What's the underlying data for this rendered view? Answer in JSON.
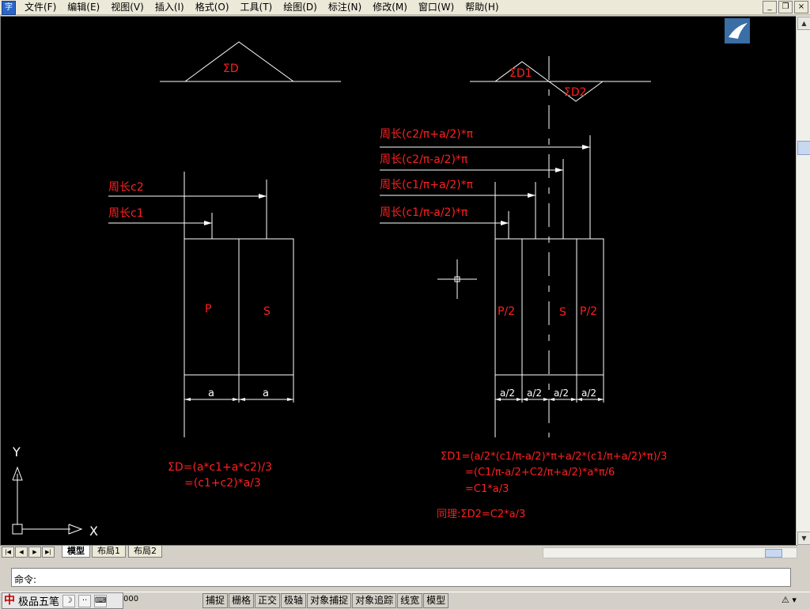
{
  "app": {
    "icon_label": "字",
    "menu": [
      "文件(F)",
      "编辑(E)",
      "视图(V)",
      "插入(I)",
      "格式(O)",
      "工具(T)",
      "绘图(D)",
      "标注(N)",
      "修改(M)",
      "窗口(W)",
      "帮助(H)"
    ],
    "window_buttons": [
      "_",
      "❐",
      "×"
    ]
  },
  "drawing": {
    "left": {
      "sum_label": "ΣD",
      "c2_label": "周长c2",
      "c1_label": "周长c1",
      "p_label": "P",
      "s_label": "S",
      "dim_a1": "a",
      "dim_a2": "a",
      "formula_line1": "ΣD=(a*c1+a*c2)/3",
      "formula_line2": "=(c1+c2)*a/3"
    },
    "right": {
      "sum1_label": "ΣD1",
      "sum2_label": "ΣD2",
      "lbl1": "周长(c2/π+a/2)*π",
      "lbl2": "周长(c2/π-a/2)*π",
      "lbl3": "周长(c1/π+a/2)*π",
      "lbl4": "周长(c1/π-a/2)*π",
      "p2_left": "P/2",
      "s_label": "S",
      "p2_right": "P/2",
      "dims": [
        "a/2",
        "a/2",
        "a/2",
        "a/2"
      ],
      "formula1": "ΣD1=(a/2*(c1/π-a/2)*π+a/2*(c1/π+a/2)*π)/3",
      "formula2": "=(C1/π-a/2+C2/π+a/2)*a*π/6",
      "formula3": "=C1*a/3",
      "formula4": "同理:ΣD2=C2*a/3"
    },
    "ucs": {
      "x_label": "X",
      "y_label": "Y"
    }
  },
  "tabs": {
    "nav": [
      "|◀",
      "◀",
      "▶",
      "▶|"
    ],
    "items": [
      "模型",
      "布局1",
      "布局2"
    ]
  },
  "command": {
    "prompt": "命令:"
  },
  "status": {
    "ime_logo": "中",
    "ime_name": "极品五笔",
    "ime_icons": [
      "☽",
      "··",
      "⌨"
    ],
    "coords": "000",
    "buttons": [
      "捕捉",
      "栅格",
      "正交",
      "极轴",
      "对象捕捉",
      "对象追踪",
      "线宽",
      "模型"
    ]
  },
  "colors": {
    "canvas_bg": "#000000",
    "line": "#ffffff",
    "text": "#ff2020"
  }
}
